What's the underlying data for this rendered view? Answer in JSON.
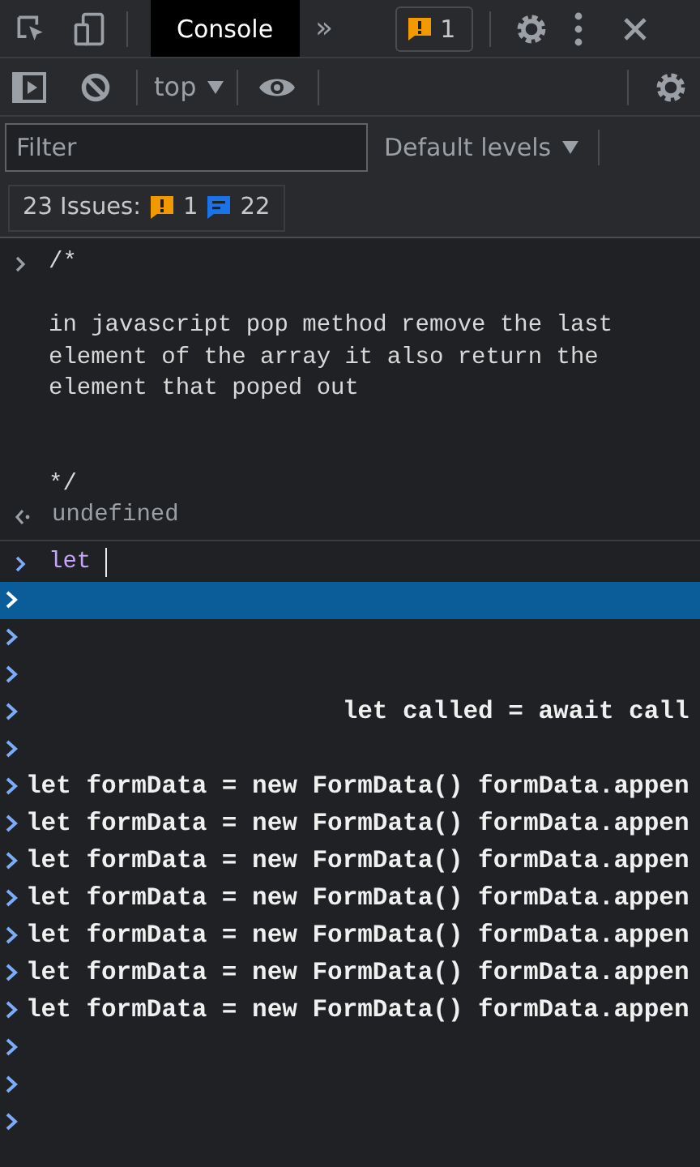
{
  "top_toolbar": {
    "tabs": [
      {
        "label": "Console",
        "selected": true
      }
    ],
    "more": "»",
    "issues_badge": "1"
  },
  "console_toolbar": {
    "context": "top"
  },
  "filter": {
    "placeholder": "Filter",
    "levels": "Default levels"
  },
  "issues_button": {
    "label": "23 Issues:",
    "warnings": "1",
    "info": "22"
  },
  "messages": [
    {
      "kind": "input",
      "text": "/*\n\nin javascript pop method remove the last\nelement of the array it also return the\nelement that poped out\n\n\n*/"
    },
    {
      "kind": "result",
      "text": "undefined"
    }
  ],
  "prompt": {
    "value": "let "
  },
  "suggestions": [
    {
      "selected": true
    },
    {
      "selected": false
    },
    {
      "selected": false
    },
    {
      "selected": false,
      "text": "                     let called = await call"
    },
    {
      "selected": false
    },
    {
      "selected": false,
      "text": "let formData = new FormData() formData.appen"
    },
    {
      "selected": false,
      "text": "let formData = new FormData() formData.appen"
    },
    {
      "selected": false,
      "text": "let formData = new FormData() formData.appen"
    },
    {
      "selected": false,
      "text": "let formData = new FormData() formData.appen"
    },
    {
      "selected": false,
      "text": "let formData = new FormData() formData.appen"
    },
    {
      "selected": false,
      "text": "let formData = new FormData() formData.appen"
    },
    {
      "selected": false,
      "text": "let formData = new FormData() formData.appen"
    },
    {
      "selected": false
    },
    {
      "selected": false
    },
    {
      "selected": false
    }
  ]
}
